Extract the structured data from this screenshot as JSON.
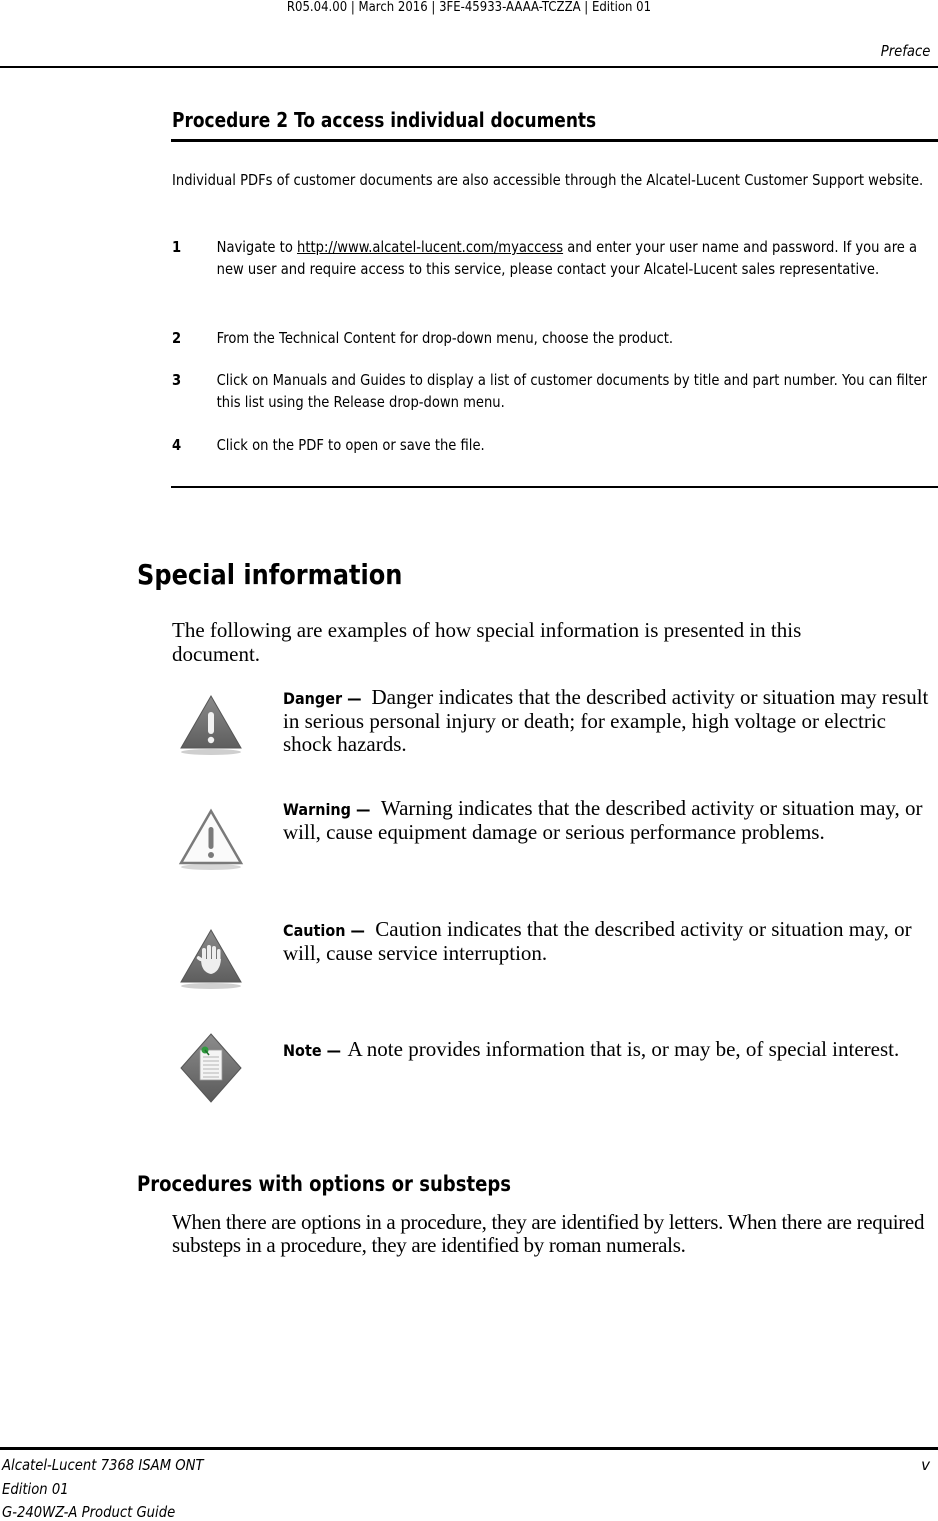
{
  "header": {
    "meta": "R05.04.00 | March 2016 | 3FE-45933-AAAA-TCZZA | Edition 01",
    "running_head": "Preface"
  },
  "procedure": {
    "title": "Procedure 2  To access individual documents",
    "intro": "Individual PDFs of customer documents are also accessible through the Alcatel-Lucent Customer Support website.",
    "steps": [
      {
        "num": "1",
        "before_link": "Navigate to ",
        "link": "http://www.alcatel-lucent.com/myaccess",
        "after_link": " and enter your user name and password. If you are a new user and require access to this service, please contact your Alcatel-Lucent sales representative."
      },
      {
        "num": "2",
        "text": "From the Technical Content for drop-down menu, choose the product."
      },
      {
        "num": "3",
        "text": "Click on Manuals and Guides to display a list of customer documents by title and part number. You can filter this list using the Release drop-down menu."
      },
      {
        "num": "4",
        "text": "Click on the PDF to open or save the file."
      }
    ]
  },
  "special": {
    "title": "Special information",
    "intro": "The following are examples of how special information is presented in this document.",
    "notices": [
      {
        "type": "danger",
        "icon": "danger-triangle-icon",
        "label": "Danger —",
        "text": " Danger indicates that the described activity or situation may result in serious personal injury or death; for example, high voltage or electric shock hazards."
      },
      {
        "type": "warning",
        "icon": "warning-triangle-icon",
        "label": "Warning —",
        "text": " Warning indicates that the described activity or situation may, or will, cause equipment damage or serious performance problems."
      },
      {
        "type": "caution",
        "icon": "caution-hand-icon",
        "label": "Caution —",
        "text": " Caution indicates that the described activity or situation may, or will, cause service interruption."
      },
      {
        "type": "note",
        "icon": "note-document-icon",
        "label": "Note —",
        "text": " A note provides information that is, or may be, of special interest."
      }
    ]
  },
  "substeps": {
    "title": "Procedures with options or substeps",
    "body": "When there are options in a procedure, they are identified by letters. When there are required substeps in a procedure, they are identified by roman numerals."
  },
  "footer": {
    "product": "Alcatel-Lucent 7368 ISAM ONT",
    "edition": "Edition 01",
    "guide": "G-240WZ-A Product Guide",
    "page": "v"
  },
  "colors": {
    "icon_gray": "#6b6b6b",
    "note_pin": "#2e9a3e"
  }
}
